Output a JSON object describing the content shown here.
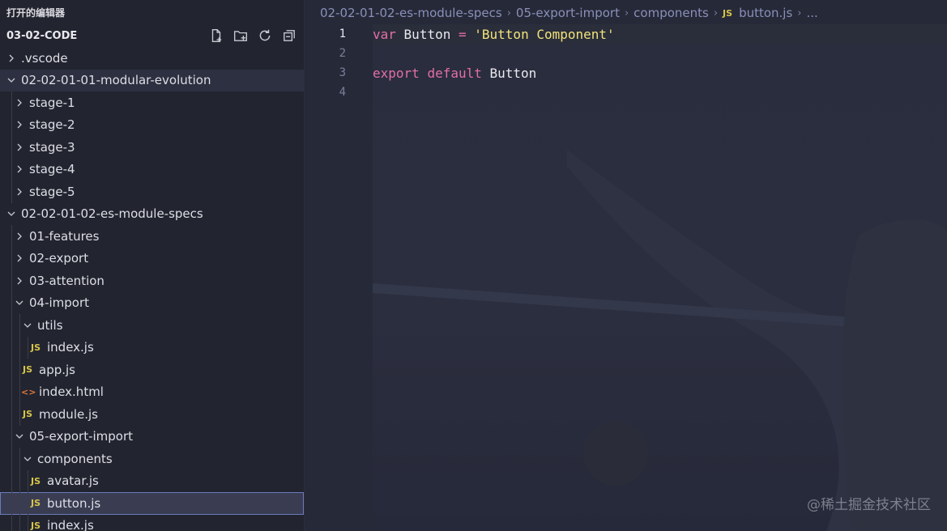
{
  "sidebar": {
    "open_editors_title": "打开的编辑器",
    "project_title": "03-02-CODE",
    "actions": [
      {
        "icon": "new-file-icon"
      },
      {
        "icon": "new-folder-icon"
      },
      {
        "icon": "refresh-icon"
      },
      {
        "icon": "collapse-all-icon"
      }
    ],
    "tree": [
      {
        "label": ".vscode",
        "type": "folder",
        "expanded": false,
        "depth": 0
      },
      {
        "label": "02-02-01-01-modular-evolution",
        "type": "folder",
        "expanded": true,
        "depth": 0
      },
      {
        "label": "stage-1",
        "type": "folder",
        "expanded": false,
        "depth": 1
      },
      {
        "label": "stage-2",
        "type": "folder",
        "expanded": false,
        "depth": 1
      },
      {
        "label": "stage-3",
        "type": "folder",
        "expanded": false,
        "depth": 1
      },
      {
        "label": "stage-4",
        "type": "folder",
        "expanded": false,
        "depth": 1
      },
      {
        "label": "stage-5",
        "type": "folder",
        "expanded": false,
        "depth": 1
      },
      {
        "label": "02-02-01-02-es-module-specs",
        "type": "folder",
        "expanded": true,
        "depth": 0
      },
      {
        "label": "01-features",
        "type": "folder",
        "expanded": false,
        "depth": 1
      },
      {
        "label": "02-export",
        "type": "folder",
        "expanded": false,
        "depth": 1
      },
      {
        "label": "03-attention",
        "type": "folder",
        "expanded": false,
        "depth": 1
      },
      {
        "label": "04-import",
        "type": "folder",
        "expanded": true,
        "depth": 1
      },
      {
        "label": "utils",
        "type": "folder",
        "expanded": true,
        "depth": 2
      },
      {
        "label": "index.js",
        "type": "js",
        "depth": 3
      },
      {
        "label": "app.js",
        "type": "js",
        "depth": 2
      },
      {
        "label": "index.html",
        "type": "html",
        "depth": 2
      },
      {
        "label": "module.js",
        "type": "js",
        "depth": 2
      },
      {
        "label": "05-export-import",
        "type": "folder",
        "expanded": true,
        "depth": 1
      },
      {
        "label": "components",
        "type": "folder",
        "expanded": true,
        "depth": 2
      },
      {
        "label": "avatar.js",
        "type": "js",
        "depth": 3
      },
      {
        "label": "button.js",
        "type": "js",
        "depth": 3,
        "selected": true
      },
      {
        "label": "index.js",
        "type": "js",
        "depth": 3
      }
    ]
  },
  "breadcrumb": {
    "items": [
      "02-02-01-02-es-module-specs",
      "05-export-import",
      "components"
    ],
    "file_icon": "JS",
    "file": "button.js",
    "more": "..."
  },
  "editor": {
    "line_numbers": [
      "1",
      "2",
      "3",
      "4"
    ],
    "lines": [
      [
        {
          "t": "var",
          "c": "kw"
        },
        {
          "t": " ",
          "c": "ident"
        },
        {
          "t": "Button",
          "c": "ident"
        },
        {
          "t": " ",
          "c": "ident"
        },
        {
          "t": "=",
          "c": "op"
        },
        {
          "t": " ",
          "c": "ident"
        },
        {
          "t": "'Button Component'",
          "c": "str"
        }
      ],
      [],
      [
        {
          "t": "export",
          "c": "kw"
        },
        {
          "t": " ",
          "c": "ident"
        },
        {
          "t": "default",
          "c": "kw"
        },
        {
          "t": " ",
          "c": "ident"
        },
        {
          "t": "Button",
          "c": "ident"
        }
      ],
      []
    ]
  },
  "watermark": "@稀土掘金技术社区",
  "colors": {
    "keyword": "#e36fa6",
    "string": "#f1e37a",
    "js_icon": "#d8c54a",
    "html_icon": "#e0773b",
    "selection_border": "#6b7bbd"
  }
}
